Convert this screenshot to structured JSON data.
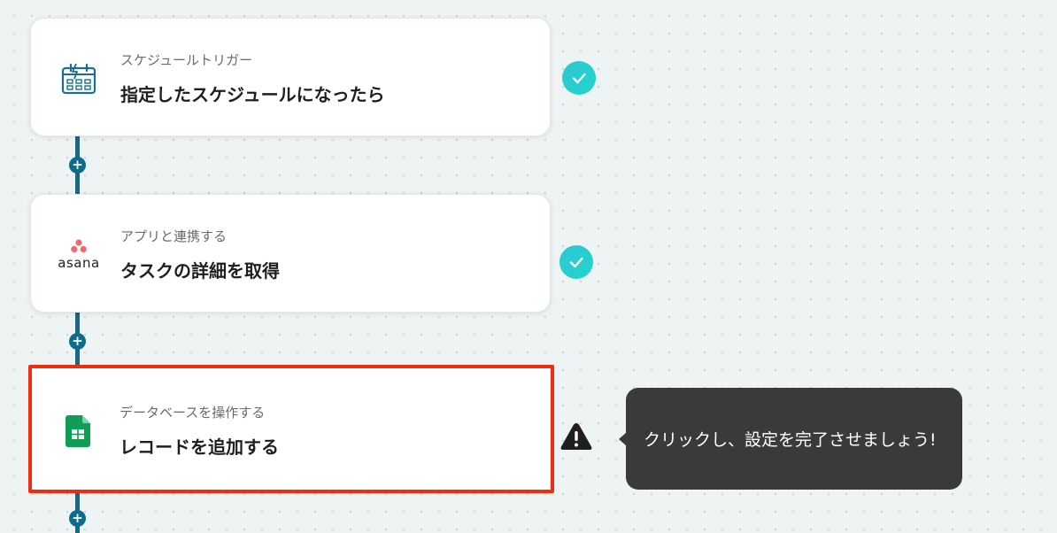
{
  "steps": [
    {
      "category": "スケジュールトリガー",
      "title": "指定したスケジュールになったら",
      "icon": "schedule-calendar-icon",
      "status": "complete"
    },
    {
      "category": "アプリと連携する",
      "title": "タスクの詳細を取得",
      "icon": "asana-logo-icon",
      "logo_text": "asana",
      "status": "complete"
    },
    {
      "category": "データベースを操作する",
      "title": "レコードを追加する",
      "icon": "google-sheets-icon",
      "status": "warning"
    }
  ],
  "add_step_symbol": "+",
  "tooltip": {
    "text": "クリックし、設定を完了させましょう!"
  },
  "colors": {
    "connector": "#0e6b8c",
    "check": "#21d4c9",
    "highlight": "#f02c12",
    "tooltip_bg": "#3a3a3a"
  }
}
